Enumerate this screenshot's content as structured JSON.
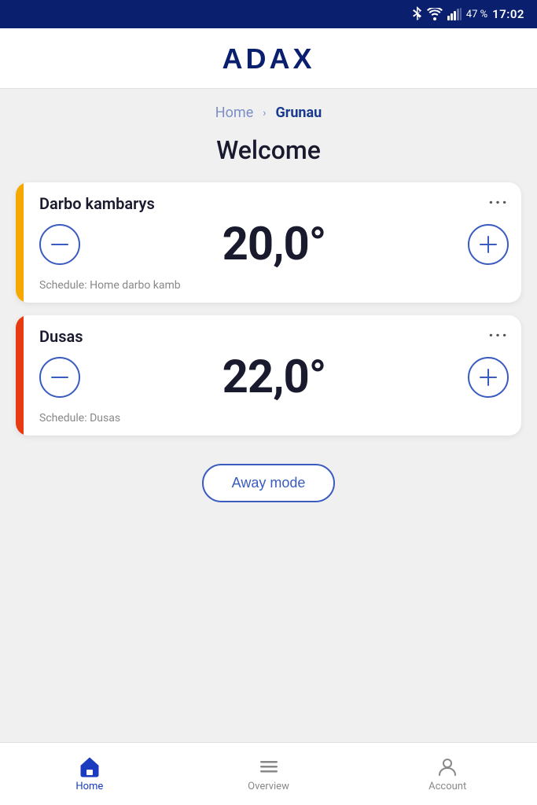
{
  "statusBar": {
    "battery": "47 %",
    "time": "17:02"
  },
  "header": {
    "logo": "ADAX"
  },
  "breadcrumb": {
    "home": "Home",
    "current": "Grunau"
  },
  "welcome": {
    "title": "Welcome"
  },
  "devices": [
    {
      "id": "device-1",
      "name": "Darbo kambarys",
      "temperature": "20,0°",
      "schedule": "Schedule: Home darbo kamb",
      "accentColor": "#f5a800"
    },
    {
      "id": "device-2",
      "name": "Dusas",
      "temperature": "22,0°",
      "schedule": "Schedule: Dusas",
      "accentColor": "#e83a10"
    }
  ],
  "awayMode": {
    "label": "Away mode"
  },
  "bottomNav": {
    "items": [
      {
        "id": "home",
        "label": "Home",
        "active": true
      },
      {
        "id": "overview",
        "label": "Overview",
        "active": false
      },
      {
        "id": "account",
        "label": "Account",
        "active": false
      }
    ]
  }
}
